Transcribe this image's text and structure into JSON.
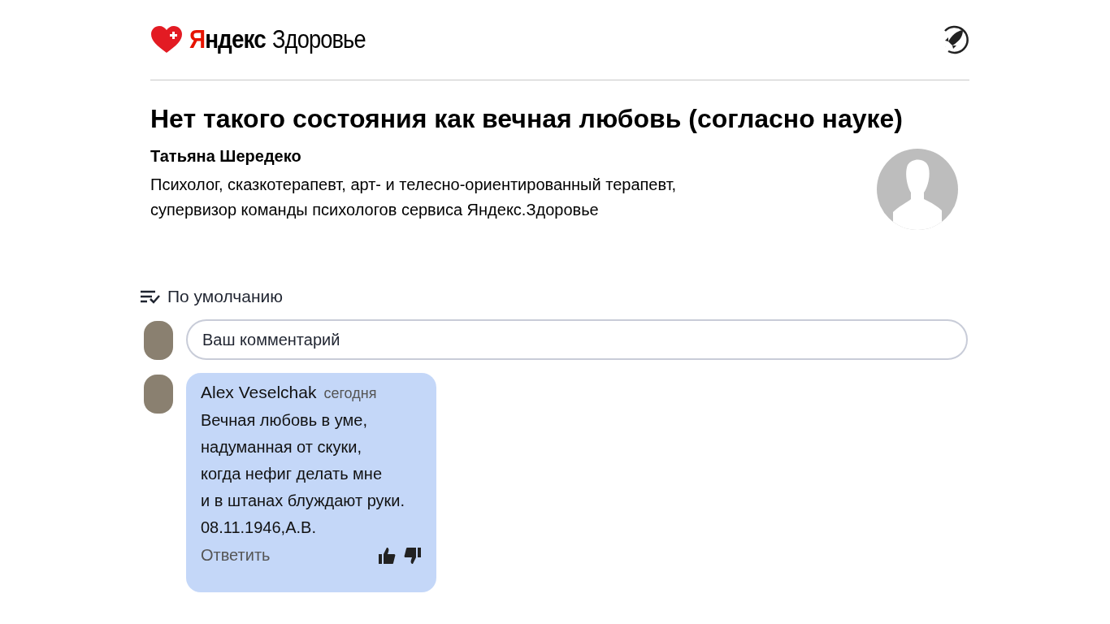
{
  "header": {
    "logo_brand": "Яндекс",
    "logo_service": "Здоровье"
  },
  "article": {
    "title": "Нет такого состояния как вечная любовь (согласно науке)",
    "author": {
      "name": "Татьяна Шередеко",
      "bio": "Психолог, сказкотерапевт, арт- и телесно-ориентированный терапевт,\nсупервизор команды психологов сервиса Яндекс.Здоровье"
    }
  },
  "comments": {
    "sort": "По умолчанию",
    "input": {
      "placeholder": "Ваш комментарий"
    },
    "items": [
      {
        "author": "Alex Veselchak",
        "time": "сегодня",
        "text": "Вечная любовь в уме,\nнадуманная от скуки,\nкогда нефиг делать мне\nи в штанах блуждают руки.\n08.11.1946,А.В.",
        "reply": "Ответить"
      }
    ]
  }
}
